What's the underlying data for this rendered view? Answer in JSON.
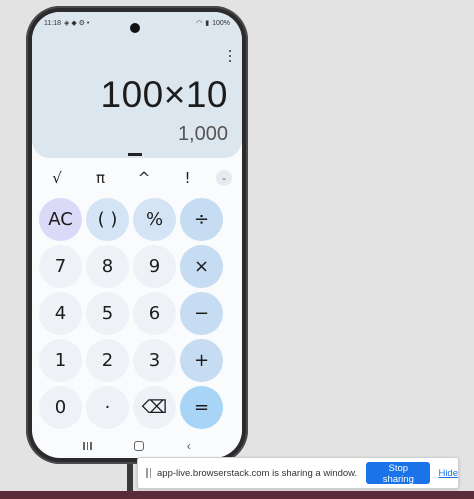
{
  "status_bar": {
    "time": "11:18",
    "left_icons": "◈ ◆ ⚙ •",
    "wifi": "◠",
    "signal": "▮",
    "battery": "100%"
  },
  "display": {
    "expression": "100×10",
    "result": "1,000"
  },
  "scientific_row": [
    "√",
    "π",
    "^",
    "!"
  ],
  "expand_icon": "⌄",
  "keypad": [
    {
      "label": "AC",
      "type": "ac",
      "name": "clear-button"
    },
    {
      "label": "( )",
      "type": "func",
      "name": "parentheses-button"
    },
    {
      "label": "%",
      "type": "func",
      "name": "percent-button"
    },
    {
      "label": "÷",
      "type": "op",
      "name": "divide-button"
    },
    {
      "label": "7",
      "type": "num",
      "name": "digit-7-button"
    },
    {
      "label": "8",
      "type": "num",
      "name": "digit-8-button"
    },
    {
      "label": "9",
      "type": "num",
      "name": "digit-9-button"
    },
    {
      "label": "×",
      "type": "op",
      "name": "multiply-button"
    },
    {
      "label": "4",
      "type": "num",
      "name": "digit-4-button"
    },
    {
      "label": "5",
      "type": "num",
      "name": "digit-5-button"
    },
    {
      "label": "6",
      "type": "num",
      "name": "digit-6-button"
    },
    {
      "label": "−",
      "type": "op",
      "name": "minus-button"
    },
    {
      "label": "1",
      "type": "num",
      "name": "digit-1-button"
    },
    {
      "label": "2",
      "type": "num",
      "name": "digit-2-button"
    },
    {
      "label": "3",
      "type": "num",
      "name": "digit-3-button"
    },
    {
      "label": "+",
      "type": "op",
      "name": "plus-button"
    },
    {
      "label": "0",
      "type": "num",
      "name": "digit-0-button"
    },
    {
      "label": "·",
      "type": "num",
      "name": "decimal-button"
    },
    {
      "label": "⌫",
      "type": "num",
      "name": "backspace-button"
    },
    {
      "label": "=",
      "type": "eq",
      "name": "equals-button"
    }
  ],
  "nav": {
    "back": "‹"
  },
  "share_bar": {
    "message": "app-live.browserstack.com is sharing a window.",
    "stop_label": "Stop sharing",
    "hide_label": "Hide"
  }
}
